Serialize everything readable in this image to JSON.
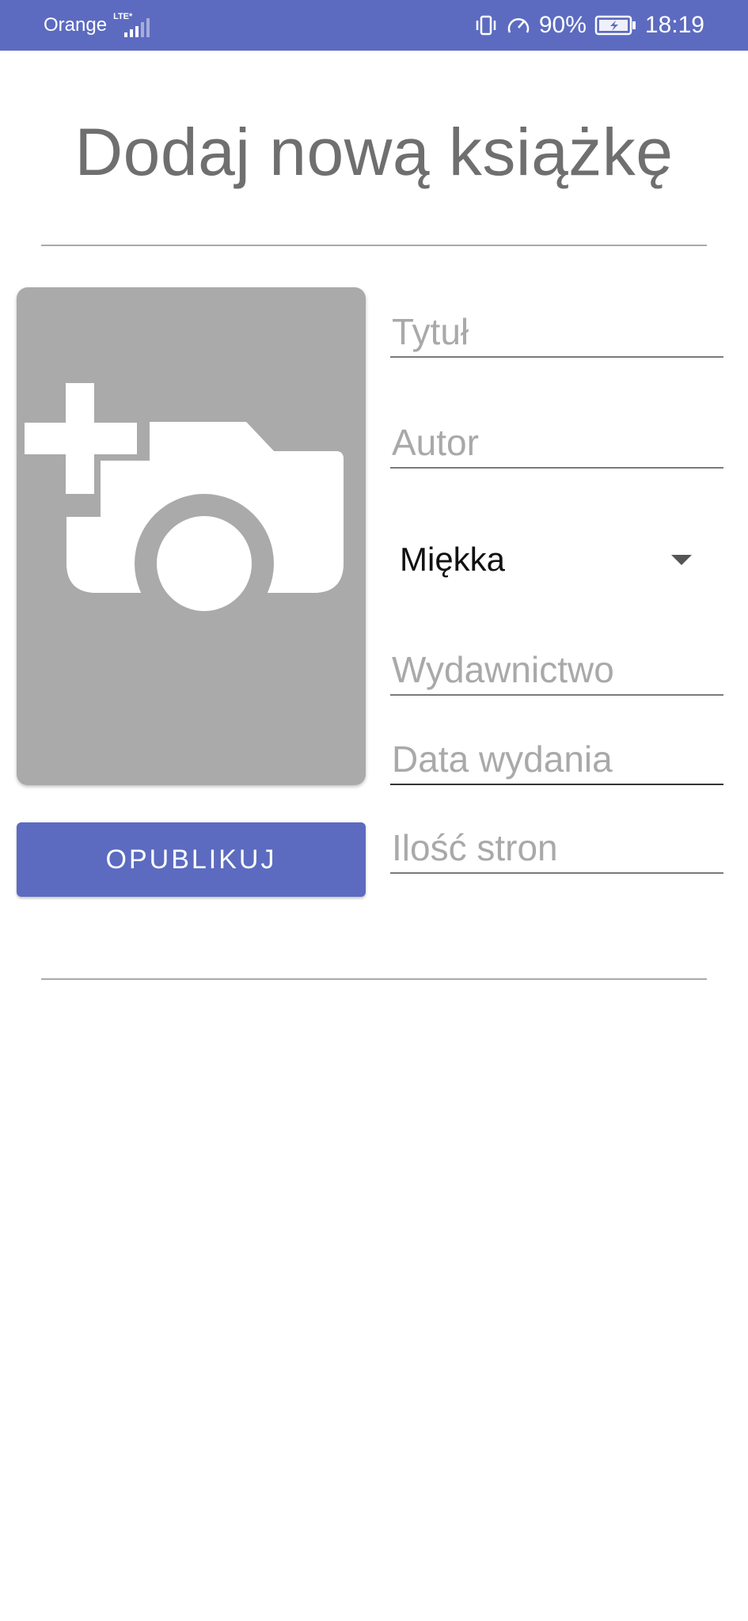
{
  "status_bar": {
    "carrier": "Orange",
    "network_type": "LTE*",
    "battery_percent": "90%",
    "time": "18:19",
    "icons": [
      "signal-icon",
      "vibrate-icon",
      "speedometer-icon",
      "battery-charging-icon"
    ]
  },
  "page": {
    "title": "Dodaj nową książkę"
  },
  "image_picker": {
    "icon": "add-photo-icon"
  },
  "form": {
    "title_placeholder": "Tytuł",
    "author_placeholder": "Autor",
    "cover_type_value": "Miękka",
    "publisher_placeholder": "Wydawnictwo",
    "date_placeholder": "Data wydania",
    "pages_placeholder": "Ilość stron"
  },
  "actions": {
    "publish_label": "OPUBLIKUJ"
  },
  "colors": {
    "primary": "#5c6bc0",
    "placeholder_bg": "#aaaaaa",
    "title_text": "#6f6f6f"
  }
}
